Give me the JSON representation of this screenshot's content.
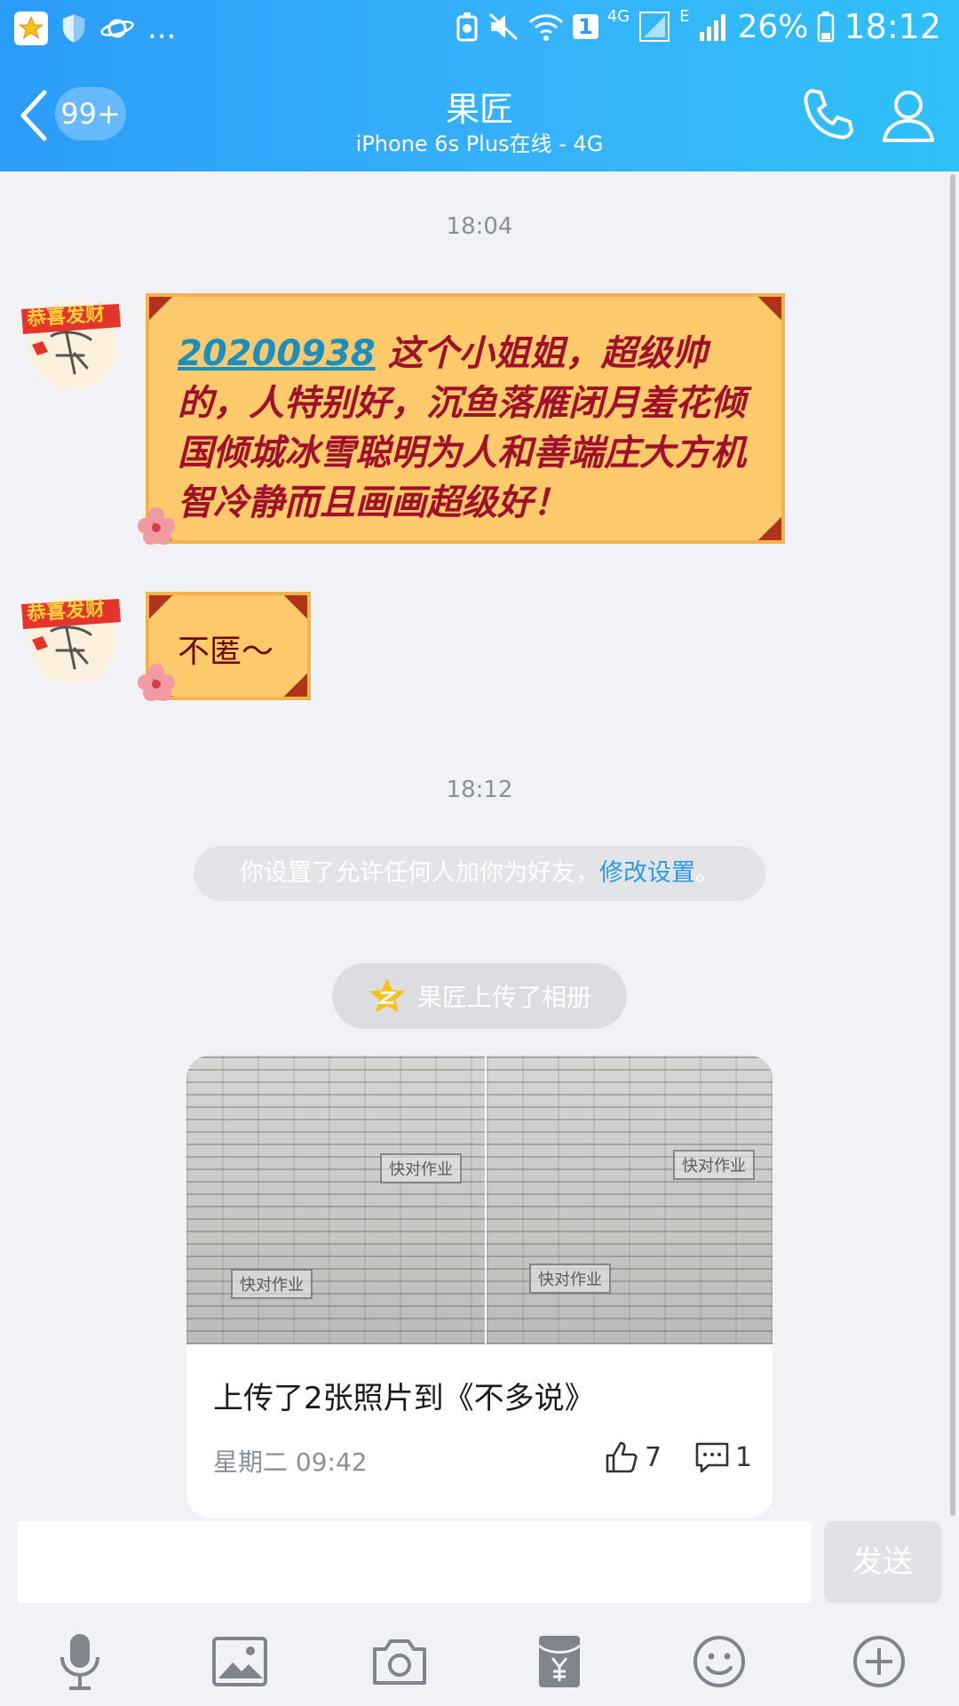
{
  "status_bar": {
    "dots": "...",
    "sim_badge": "1",
    "network_4g": "4G",
    "network_e": "E",
    "battery": "26%",
    "time": "18:12"
  },
  "header": {
    "unread_count": "99+",
    "title": "果匠",
    "subtitle": "iPhone 6s Plus在线 - 4G",
    "accent_color": "#2b9cf8"
  },
  "messages": {
    "timestamp1": "18:04",
    "msg1_mention": "20200938",
    "msg1_text": " 这个小姐姐，超级帅的，人特别好，沉鱼落雁闭月羞花倾国倾城冰雪聪明为人和善端庄大方机智冷静而且画画超级好！",
    "msg2_text": "不匿～",
    "avatar_label": "恭喜发财",
    "timestamp2": "18:12",
    "notice_text": "你设置了允许任何人加你为好友，",
    "notice_link": "修改设置",
    "notice_end": "。",
    "album_pill": "果匠上传了相册"
  },
  "album_card": {
    "photo_watermark": "快对作业",
    "description": "上传了2张照片到《不多说》",
    "date": "星期二 09:42",
    "likes": "7",
    "comments": "1"
  },
  "input": {
    "placeholder": "",
    "send_label": "发送"
  },
  "toolbar": {
    "icons": [
      "microphone-icon",
      "image-icon",
      "camera-icon",
      "red-packet-icon",
      "emoji-icon",
      "plus-icon"
    ]
  }
}
